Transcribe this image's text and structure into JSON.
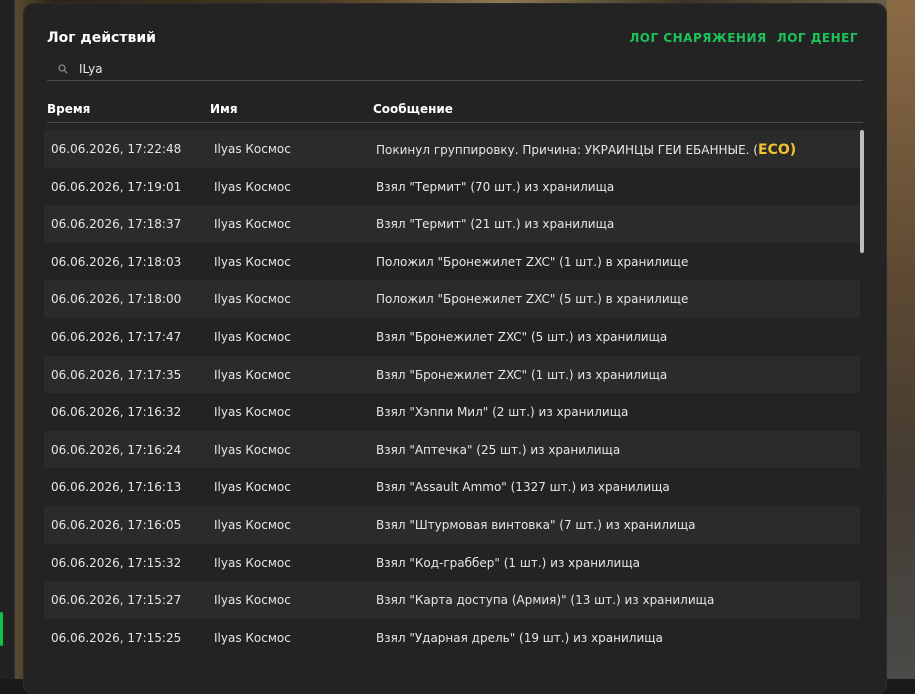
{
  "title": "Лог действий",
  "top_links": [
    "ЛОГ СНАРЯЖЕНИЯ",
    "ЛОГ ДЕНЕГ"
  ],
  "search": {
    "value": "ILya",
    "icon": "search-icon"
  },
  "columns": [
    "Время",
    "Имя",
    "Сообщение"
  ],
  "rows": [
    {
      "time": "06.06.2026, 17:22:48",
      "name": "Ilyas Космос",
      "message": "Покинул группировку. Причина: УКРАИНЦЫ ГЕИ ЕБАННЫЕ. (",
      "tag": "ECO)"
    },
    {
      "time": "06.06.2026, 17:19:01",
      "name": "Ilyas Космос",
      "message": "Взял \"Термит\" (70 шт.) из хранилища"
    },
    {
      "time": "06.06.2026, 17:18:37",
      "name": "Ilyas Космос",
      "message": "Взял \"Термит\" (21 шт.) из хранилища"
    },
    {
      "time": "06.06.2026, 17:18:03",
      "name": "Ilyas Космос",
      "message": "Положил \"Бронежилет ZXC\" (1 шт.) в хранилище"
    },
    {
      "time": "06.06.2026, 17:18:00",
      "name": "Ilyas Космос",
      "message": "Положил \"Бронежилет ZXC\" (5 шт.) в хранилище"
    },
    {
      "time": "06.06.2026, 17:17:47",
      "name": "Ilyas Космос",
      "message": "Взял \"Бронежилет ZXC\" (5 шт.) из хранилища"
    },
    {
      "time": "06.06.2026, 17:17:35",
      "name": "Ilyas Космос",
      "message": "Взял \"Бронежилет ZXC\" (1 шт.) из хранилища"
    },
    {
      "time": "06.06.2026, 17:16:32",
      "name": "Ilyas Космос",
      "message": "Взял \"Хэппи Мил\" (2 шт.) из хранилища"
    },
    {
      "time": "06.06.2026, 17:16:24",
      "name": "Ilyas Космос",
      "message": "Взял \"Аптечка\" (25 шт.) из хранилища"
    },
    {
      "time": "06.06.2026, 17:16:13",
      "name": "Ilyas Космос",
      "message": "Взял \"Assault Ammo\" (1327 шт.) из хранилища"
    },
    {
      "time": "06.06.2026, 17:16:05",
      "name": "Ilyas Космос",
      "message": "Взял \"Штурмовая винтовка\" (7 шт.) из хранилища"
    },
    {
      "time": "06.06.2026, 17:15:32",
      "name": "Ilyas Космос",
      "message": "Взял \"Код-граббер\" (1 шт.) из хранилища"
    },
    {
      "time": "06.06.2026, 17:15:27",
      "name": "Ilyas Космос",
      "message": "Взял \"Карта доступа (Армия)\" (13 шт.) из хранилища"
    },
    {
      "time": "06.06.2026, 17:15:25",
      "name": "Ilyas Космос",
      "message": "Взял \"Ударная дрель\" (19 шт.) из хранилища"
    }
  ],
  "colors": {
    "accent": "#1cc35a",
    "tag": "#f2c230",
    "panel": "#232323",
    "row_alt": "#2b2b2b"
  }
}
